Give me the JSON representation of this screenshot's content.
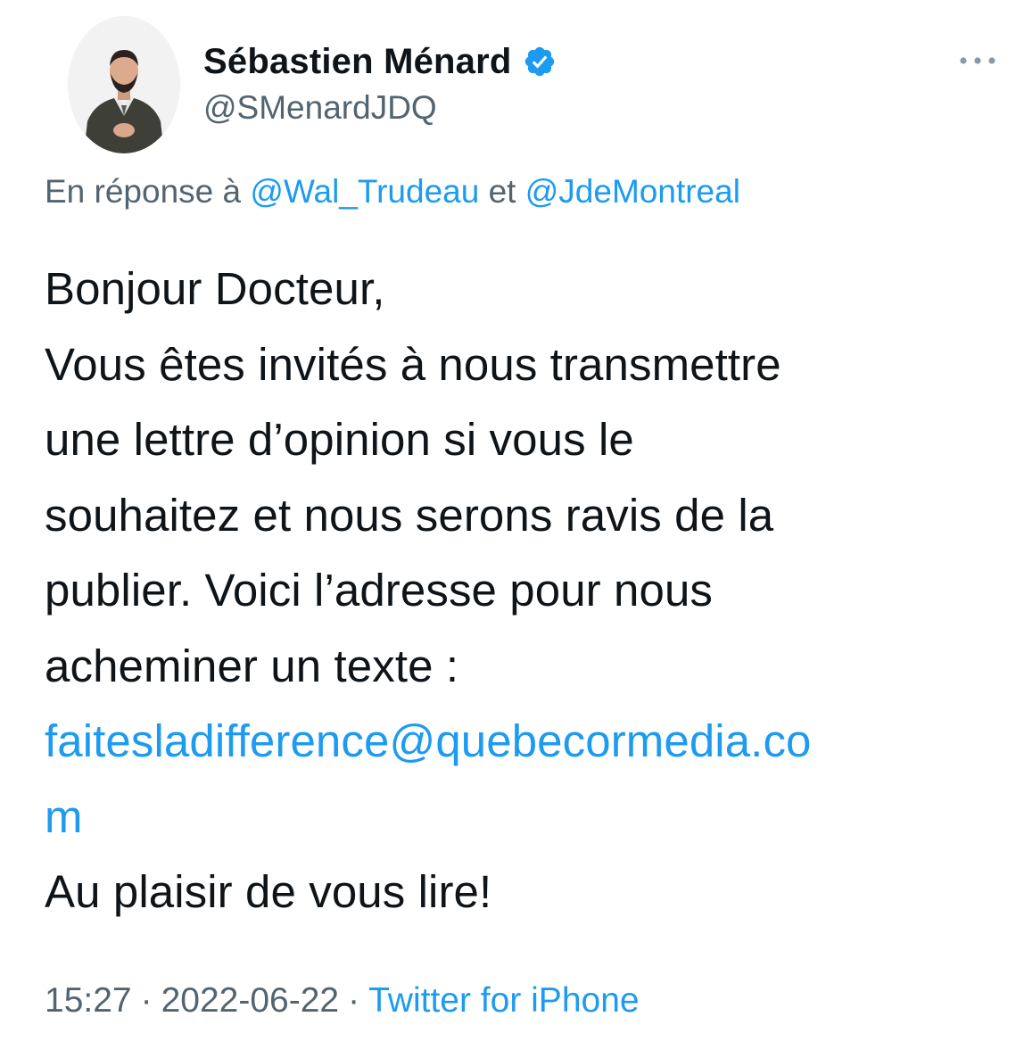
{
  "author": {
    "display_name": "Sébastien Ménard",
    "handle": "@SMenardJDQ",
    "verified_icon": "verified-badge-icon",
    "avatar_icon": "profile-photo"
  },
  "more_icon": "more-horizontal-icon",
  "reply_context": {
    "prefix": "En réponse à",
    "mention_1": "@Wal_Trudeau",
    "conjunction": "et",
    "mention_2": "@JdeMontreal"
  },
  "tweet": {
    "lines": [
      "Bonjour Docteur,",
      "Vous êtes invités à nous transmettre",
      "une lettre d’opinion si vous le",
      "souhaitez et nous serons ravis de la",
      "publier. Voici l’adresse pour nous",
      "acheminer un texte :"
    ],
    "email_line_1": "faitesladifference@quebecormedia.co",
    "email_line_2": "m",
    "closing": "Au plaisir de vous lire!"
  },
  "meta": {
    "time": "15:27",
    "separator": "·",
    "date": "2022-06-22",
    "source": "Twitter for iPhone"
  },
  "colors": {
    "link": "#1d9bf0",
    "secondary_text": "#536471",
    "primary_text": "#0f1419",
    "verified": "#1d9bf0"
  }
}
